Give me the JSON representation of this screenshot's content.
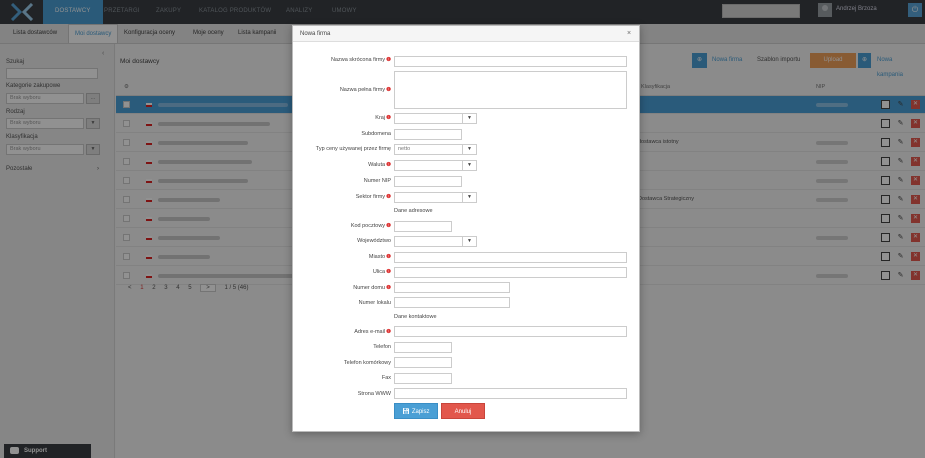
{
  "topnav": {
    "items": [
      "DOSTAWCY",
      "PRZETARGI",
      "ZAKUPY",
      "KATALOG PRODUKTÓW",
      "ANALIZY",
      "UMOWY"
    ],
    "user": "Andrzej Brzoza"
  },
  "subnav": {
    "tabs": [
      "Lista dostawców",
      "Moi dostawcy",
      "Konfiguracja oceny",
      "Moje oceny",
      "Lista kampanii"
    ]
  },
  "leftpanel": {
    "search_label": "Szukaj",
    "category_label": "Kategorie zakupowe",
    "category_value": "Brak wyboru",
    "kind_label": "Rodzaj",
    "kind_value": "Brak wyboru",
    "class_label": "Klasyfikacja",
    "class_value": "Brak wyboru",
    "other_label": "Pozostałe",
    "browse_btn": "...",
    "support": "Support"
  },
  "main": {
    "title": "Moi dostawcy",
    "btn_new": "Nowa firma",
    "btn_template": "Szablon importu",
    "btn_upload": "Upload",
    "btn_campaign": "Nowa kampania",
    "col_class": "Klasyfikacja",
    "col_nip": "NIP",
    "row_classes": [
      "",
      "",
      "dostawca istotny",
      "",
      "",
      "Dostawca Strategiczny",
      "",
      "",
      "",
      ""
    ],
    "pager": {
      "prev": "<",
      "pages": [
        "1",
        "2",
        "3",
        "4",
        "5"
      ],
      "next": ">",
      "info": "1 / 5 (46)"
    }
  },
  "modal": {
    "title": "Nowa firma",
    "close": "×",
    "labels": {
      "short_name": "Nazwa skrócona firmy",
      "full_name": "Nazwa pełna firmy",
      "country": "Kraj",
      "subdomain": "Subdomena",
      "price_type": "Typ ceny używanej przez firmę",
      "currency": "Waluta",
      "nip": "Numer NIP",
      "sector": "Sektor firmy",
      "address_section": "Dane adresowe",
      "postal": "Kod pocztowy",
      "province": "Województwo",
      "city": "Miasto",
      "street": "Ulica",
      "house_no": "Numer domu",
      "apt_no": "Numer lokalu",
      "contact_section": "Dane kontaktowe",
      "email": "Adres e-mail",
      "phone": "Telefon",
      "mobile": "Telefon komórkowy",
      "fax": "Fax",
      "www": "Strona WWW"
    },
    "values": {
      "price_type": "netto"
    },
    "required_mark": "❶",
    "save_label": "Zapisz",
    "cancel_label": "Anuluj"
  },
  "colors": {
    "accent": "#4a9fd5",
    "danger": "#e2574c",
    "nav_bg": "#3b3f44",
    "upload": "#f0a05a"
  }
}
